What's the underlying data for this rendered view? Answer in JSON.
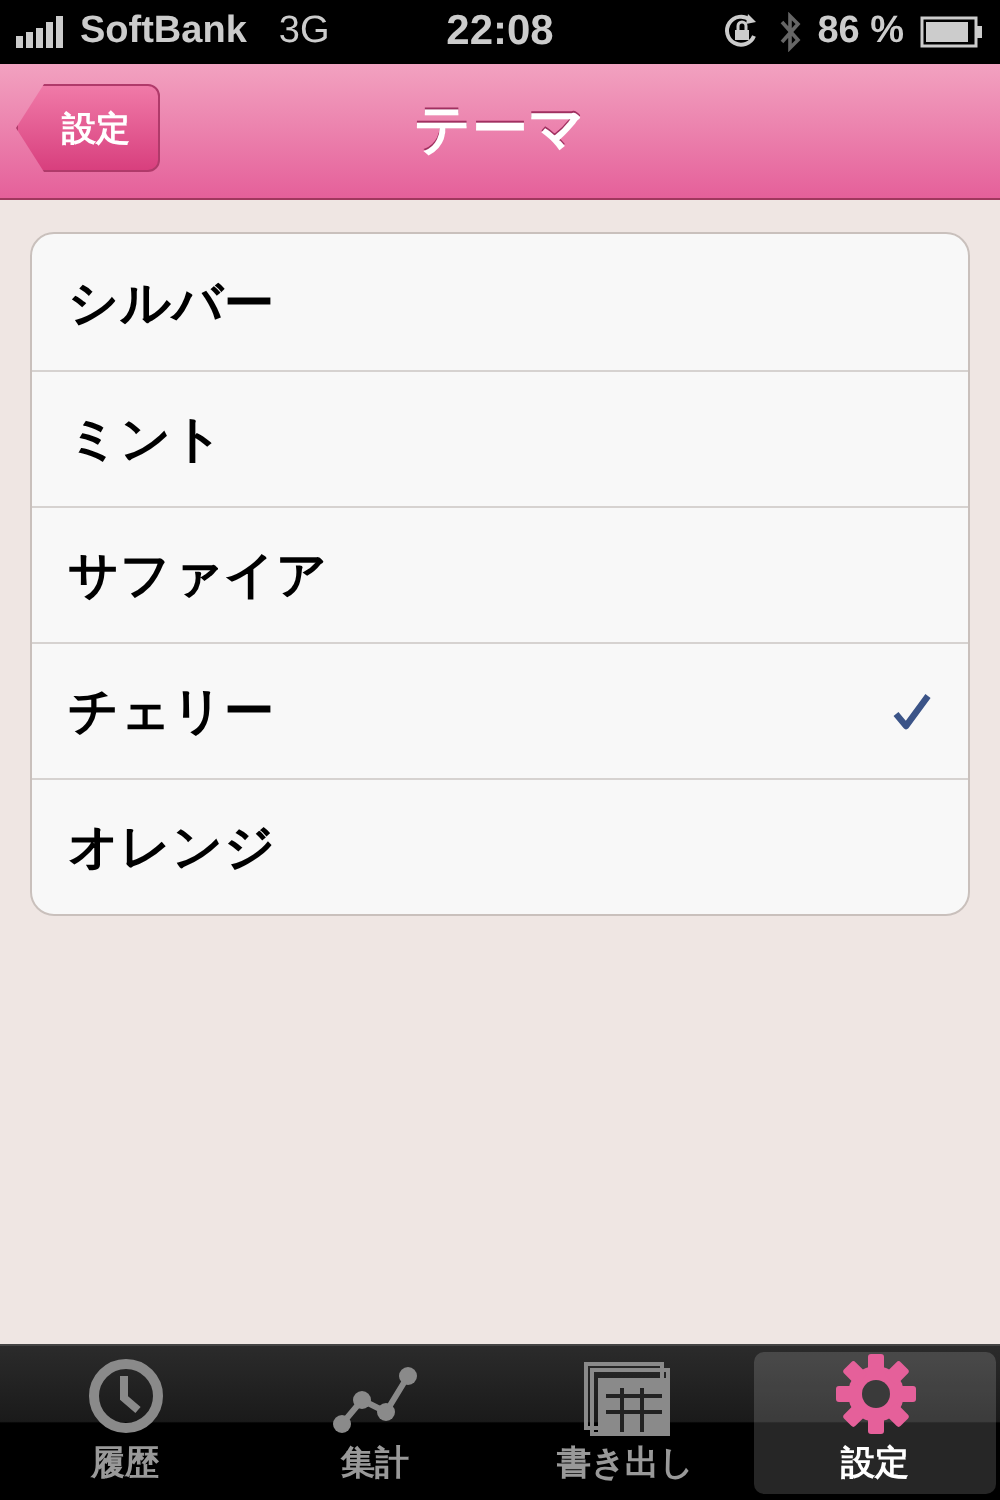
{
  "status_bar": {
    "carrier": "SoftBank",
    "network": "3G",
    "time": "22:08",
    "battery": "86 %"
  },
  "nav_bar": {
    "back_button": "設定",
    "title": "テーマ"
  },
  "themes": [
    {
      "label": "シルバー",
      "selected": false
    },
    {
      "label": "ミント",
      "selected": false
    },
    {
      "label": "サファイア",
      "selected": false
    },
    {
      "label": "チェリー",
      "selected": true
    },
    {
      "label": "オレンジ",
      "selected": false
    }
  ],
  "tab_bar": [
    {
      "label": "履歴",
      "kind": "clock",
      "selected": false
    },
    {
      "label": "集計",
      "kind": "chart",
      "selected": false
    },
    {
      "label": "書き出し",
      "kind": "export",
      "selected": false
    },
    {
      "label": "設定",
      "kind": "gear",
      "selected": true
    }
  ]
}
